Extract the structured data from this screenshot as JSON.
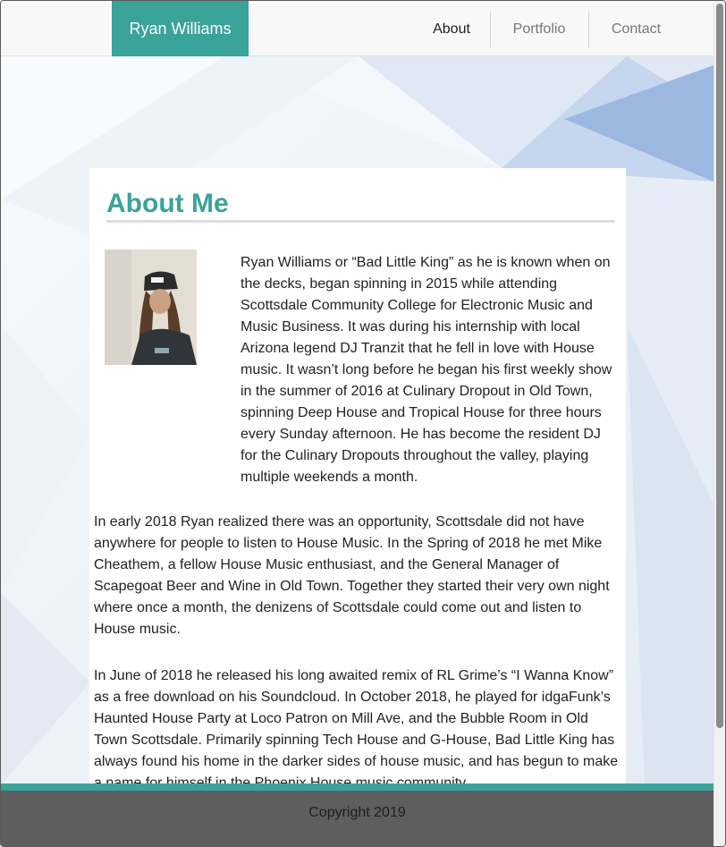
{
  "navbar": {
    "brand": "Ryan Williams",
    "links": [
      "About",
      "Portfolio",
      "Contact"
    ],
    "active": "About"
  },
  "main": {
    "title": "About Me",
    "photo_icon": "portrait-photo",
    "paragraphs": [
      "Ryan Williams or “Bad Little King” as he is known when on the decks, began spinning in 2015 while attending Scottsdale Community College for Electronic Music and Music Business. It was during his internship with local Arizona legend DJ Tranzit that he fell in love with House music. It wasn’t long before he began his first weekly show in the summer of 2016 at Culinary Dropout in Old Town, spinning Deep House and Tropical House for three hours every Sunday afternoon. He has become the resident DJ for the Culinary Dropouts throughout the valley, playing multiple weekends a month.",
      "In early 2018 Ryan realized there was an opportunity, Scottsdale did not have anywhere for people to listen to House Music. In the Spring of 2018 he met Mike Cheathem, a fellow House Music enthusiast, and the General Manager of Scapegoat Beer and Wine in Old Town. Together they started their very own night where once a month, the denizens of Scottsdale could come out and listen to House music.",
      "In June of 2018 he released his long awaited remix of RL Grime’s “I Wanna Know” as a free download on his Soundcloud. In October 2018, he played for idgaFunk’s Haunted House Party at Loco Patron on Mill Ave, and the Bubble Room in Old Town Scottsdale. Primarily spinning Tech House and G-House, Bad Little King has always found his home in the darker sides of house music, and has begun to make a name for himself in the Phoenix House music community."
    ]
  },
  "footer": {
    "copyright": "Copyright 2019"
  },
  "colors": {
    "accent": "#3aa39a",
    "footer_bg": "#5e5e5e",
    "navbar_bg": "#f8f8f8"
  }
}
